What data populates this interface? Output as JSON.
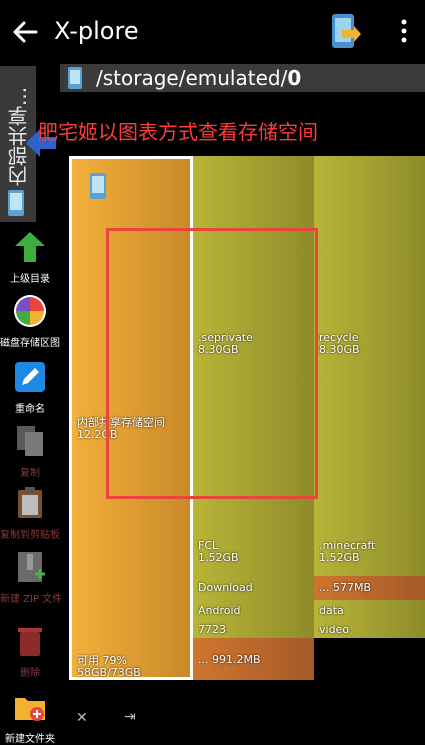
{
  "app": {
    "title": "X-plore"
  },
  "path": {
    "prefix": "/storage/emulated/",
    "last": "0"
  },
  "side_tab": {
    "label": "内部共享..."
  },
  "annotation": {
    "text": "肥宅姬以图表方式查看存储空间"
  },
  "toolbar": [
    {
      "id": "up",
      "label": "上级目录",
      "icon": "up-arrow-icon"
    },
    {
      "id": "disk-map",
      "label": "磁盘存储区图",
      "icon": "pie-chart-icon"
    },
    {
      "id": "rename",
      "label": "重命名",
      "icon": "pencil-icon"
    },
    {
      "id": "copy",
      "label": "复制",
      "icon": "copy-icon"
    },
    {
      "id": "copy-clip",
      "label": "复制到剪贴板",
      "icon": "clipboard-icon"
    },
    {
      "id": "new-zip",
      "label": "新建 ZIP 文件",
      "icon": "zip-icon"
    },
    {
      "id": "delete",
      "label": "删除",
      "icon": "trash-icon"
    },
    {
      "id": "new-folder",
      "label": "新建文件夹",
      "icon": "new-folder-icon"
    }
  ],
  "treemap": {
    "root": {
      "name": "内部共享存储空间",
      "size": "12.2GB",
      "free": "可用 79%",
      "usage": "58GB/73GB"
    },
    "items": [
      {
        "id": "seprivate",
        "name": ".seprivate",
        "size": "8.30GB"
      },
      {
        "id": "recycle",
        "name": "recycle",
        "size": "8.30GB"
      },
      {
        "id": "fcl",
        "name": "FCL",
        "size": "1.52GB"
      },
      {
        "id": "minecraft",
        "name": ".minecraft",
        "size": "1.52GB"
      },
      {
        "id": "download",
        "name": "Download",
        "size": ""
      },
      {
        "id": "more1",
        "name": "... 577MB",
        "size": ""
      },
      {
        "id": "android",
        "name": "Android",
        "size": ""
      },
      {
        "id": "data",
        "name": "data",
        "size": ""
      },
      {
        "id": "n7723",
        "name": "7723",
        "size": ""
      },
      {
        "id": "video",
        "name": "video",
        "size": ""
      },
      {
        "id": "more2",
        "name": "... 991.2MB",
        "size": ""
      }
    ]
  },
  "colors": {
    "annotation": "#ff3b3b",
    "selection": "#ffffff",
    "highlight": "#e8453c",
    "accent": "#f4b031"
  }
}
